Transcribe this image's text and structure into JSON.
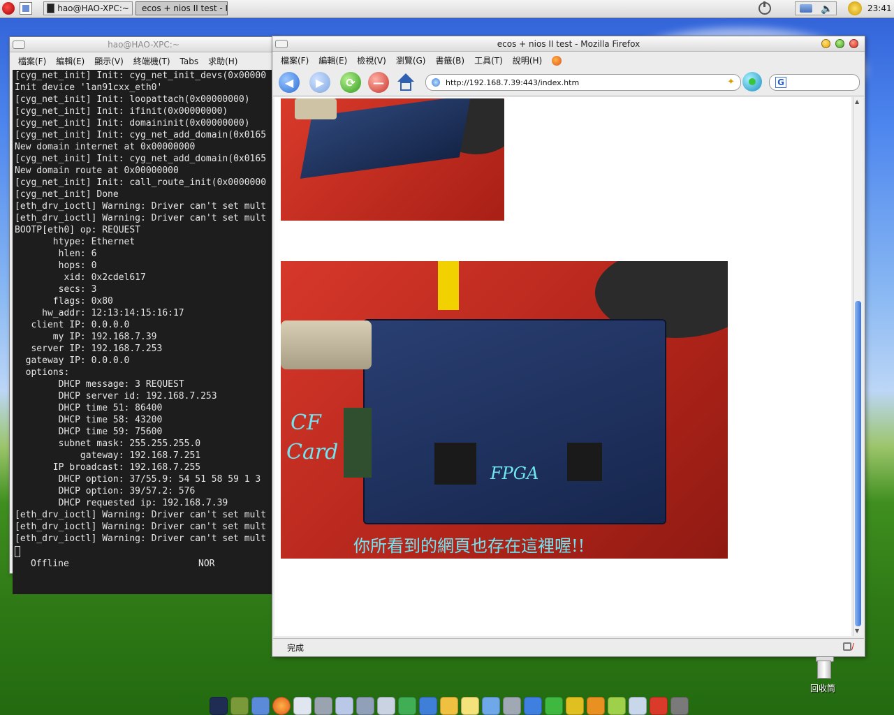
{
  "top_panel": {
    "tasks": [
      {
        "label": "hao@HAO-XPC:~"
      },
      {
        "label": "ecos + nios II test - I"
      }
    ],
    "clock": "23:41"
  },
  "terminal": {
    "title": "hao@HAO-XPC:~",
    "menu": [
      "檔案(F)",
      "編輯(E)",
      "顯示(V)",
      "終端機(T)",
      "Tabs",
      "求助(H)"
    ],
    "lines": [
      "[cyg_net_init] Init: cyg_net_init_devs(0x00000",
      "Init device 'lan91cxx_eth0'",
      "[cyg_net_init] Init: loopattach(0x00000000)",
      "[cyg_net_init] Init: ifinit(0x00000000)",
      "[cyg_net_init] Init: domaininit(0x00000000)",
      "[cyg_net_init] Init: cyg_net_add_domain(0x0165",
      "New domain internet at 0x00000000",
      "[cyg_net_init] Init: cyg_net_add_domain(0x0165",
      "New domain route at 0x00000000",
      "[cyg_net_init] Init: call_route_init(0x0000000",
      "[cyg_net_init] Done",
      "[eth_drv_ioctl] Warning: Driver can't set mult",
      "[eth_drv_ioctl] Warning: Driver can't set mult",
      "BOOTP[eth0] op: REQUEST",
      "       htype: Ethernet",
      "        hlen: 6",
      "        hops: 0",
      "         xid: 0x2cdel617",
      "        secs: 3",
      "       flags: 0x80",
      "     hw_addr: 12:13:14:15:16:17",
      "   client IP: 0.0.0.0",
      "       my IP: 192.168.7.39",
      "   server IP: 192.168.7.253",
      "  gateway IP: 0.0.0.0",
      "  options:",
      "        DHCP message: 3 REQUEST",
      "        DHCP server id: 192.168.7.253",
      "        DHCP time 51: 86400",
      "        DHCP time 58: 43200",
      "        DHCP time 59: 75600",
      "        subnet mask: 255.255.255.0",
      "            gateway: 192.168.7.251",
      "       IP broadcast: 192.168.7.255",
      "        DHCP option: 37/55.9: 54 51 58 59 1 3",
      "        DHCP option: 39/57.2: 576",
      "        DHCP requested ip: 192.168.7.39",
      "[eth_drv_ioctl] Warning: Driver can't set mult",
      "[eth_drv_ioctl] Warning: Driver can't set mult",
      "[eth_drv_ioctl] Warning: Driver can't set mult",
      ""
    ],
    "status_left": "Offline",
    "status_right": "NOR"
  },
  "browser": {
    "title": "ecos + nios II test - Mozilla Firefox",
    "menu": [
      "檔案(F)",
      "編輯(E)",
      "檢視(V)",
      "瀏覽(G)",
      "書籤(B)",
      "工具(T)",
      "說明(H)"
    ],
    "url": "http://192.168.7.39:443/index.htm",
    "search_engine_glyph": "G",
    "status": "完成",
    "photo_annotations": {
      "cf": "CF",
      "card": "Card",
      "fpga": "FPGA",
      "caption": "你所看到的網頁也存在這裡喔!!"
    }
  },
  "desktop": {
    "trash_label": "回收筒"
  },
  "colors": {
    "terminal_bg": "#1d1d1d",
    "annotation": "#6fe6f2",
    "board_blue": "#1e2f5a",
    "bag_red": "#c0281e"
  }
}
